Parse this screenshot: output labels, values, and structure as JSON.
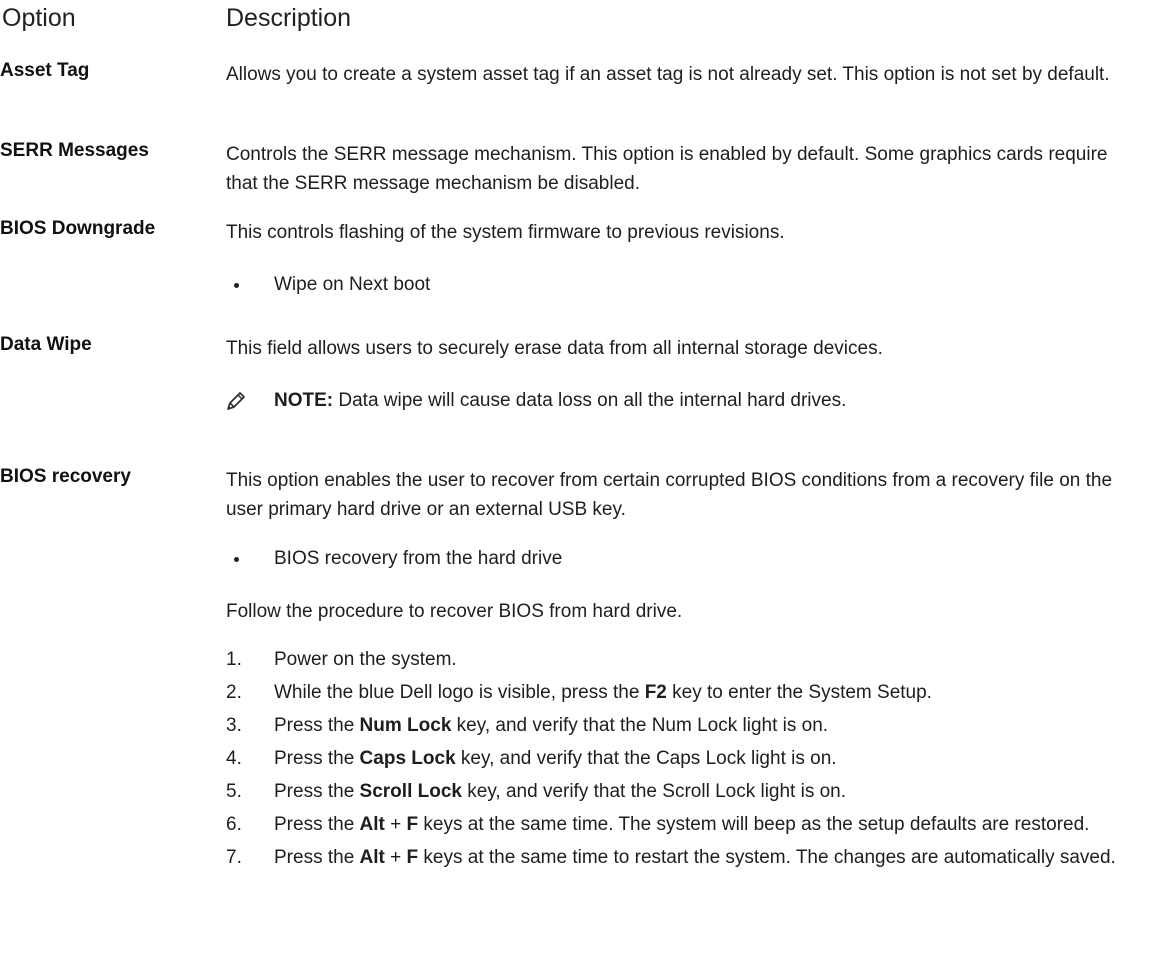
{
  "header": {
    "option_label": "Option",
    "description_label": "Description"
  },
  "rows": [
    {
      "label": "Asset Tag",
      "description": "Allows you to create a system asset tag if an asset tag is not already set. This option is not set by default."
    },
    {
      "label": "SERR Messages",
      "description": "Controls the SERR message mechanism. This option is enabled by default. Some graphics cards require that the SERR message mechanism be disabled."
    },
    {
      "label": "BIOS Downgrade",
      "description": "This controls flashing of the system firmware to previous revisions.",
      "bullet": "Wipe on Next boot"
    },
    {
      "label": "Data Wipe",
      "description": "This field allows users to securely erase data from all internal storage devices.",
      "note_label": "NOTE:",
      "note_text": " Data wipe will cause data loss on all the internal hard drives."
    },
    {
      "label": "BIOS recovery",
      "description": "This option enables the user to recover from certain corrupted BIOS conditions from a recovery file on the user primary hard drive or an external USB key.",
      "bullet": "BIOS recovery from the hard drive",
      "procedure_intro": "Follow the procedure to recover BIOS from hard drive.",
      "steps": [
        {
          "num": "1.",
          "parts": [
            "Power on the system."
          ]
        },
        {
          "num": "2.",
          "parts": [
            "While the blue Dell logo is visible, press the ",
            "F2",
            " key to enter the System Setup."
          ]
        },
        {
          "num": "3.",
          "parts": [
            "Press the ",
            "Num Lock",
            " key, and verify that the Num Lock light is on."
          ]
        },
        {
          "num": "4.",
          "parts": [
            "Press the ",
            "Caps Lock",
            " key, and verify that the Caps Lock light is on."
          ]
        },
        {
          "num": "5.",
          "parts": [
            "Press the ",
            "Scroll Lock",
            " key, and verify that the Scroll Lock light is on."
          ]
        },
        {
          "num": "6.",
          "parts": [
            "Press the ",
            "Alt",
            " + ",
            "F",
            " keys at the same time. The system will beep as the setup defaults are restored."
          ]
        },
        {
          "num": "7.",
          "parts": [
            "Press the ",
            "Alt",
            " + ",
            "F",
            " keys at the same time to restart the system. The changes are automatically saved."
          ]
        }
      ]
    }
  ]
}
